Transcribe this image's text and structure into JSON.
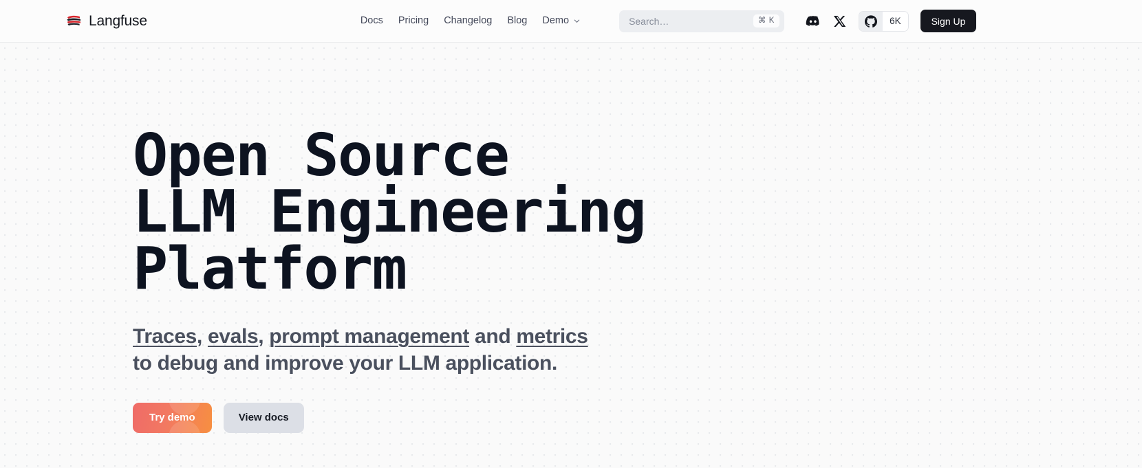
{
  "header": {
    "brand": {
      "name": "Langfuse",
      "icon": "langfuse-logo-icon",
      "mark_color": "#d8232a"
    },
    "nav": [
      {
        "label": "Docs",
        "icon": null
      },
      {
        "label": "Pricing",
        "icon": null
      },
      {
        "label": "Changelog",
        "icon": null
      },
      {
        "label": "Blog",
        "icon": null
      },
      {
        "label": "Demo",
        "icon": "chevron-down-icon"
      }
    ],
    "search": {
      "placeholder": "Search…",
      "value": "",
      "shortcut": "⌘ K"
    },
    "social": [
      {
        "name": "discord-icon",
        "label": "Discord"
      },
      {
        "name": "x-icon",
        "label": "X"
      }
    ],
    "github": {
      "icon": "github-icon",
      "stars": "6K"
    },
    "signup_label": "Sign Up"
  },
  "hero": {
    "headline": "Open Source\nLLM Engineering\nPlatform",
    "subhead": {
      "links": [
        {
          "label": "Traces"
        },
        {
          "label": "evals"
        },
        {
          "label": "prompt management"
        },
        {
          "label": "metrics"
        }
      ],
      "sep1": ", ",
      "sep2": ", ",
      "conjunction": " and ",
      "line2": "to debug and improve your LLM application."
    },
    "cta": {
      "primary_label": "Try demo",
      "secondary_label": "View docs",
      "primary_gradient_from": "#ef6b67",
      "primary_gradient_to": "#f78f41",
      "secondary_bg": "#dcdfe6"
    }
  }
}
